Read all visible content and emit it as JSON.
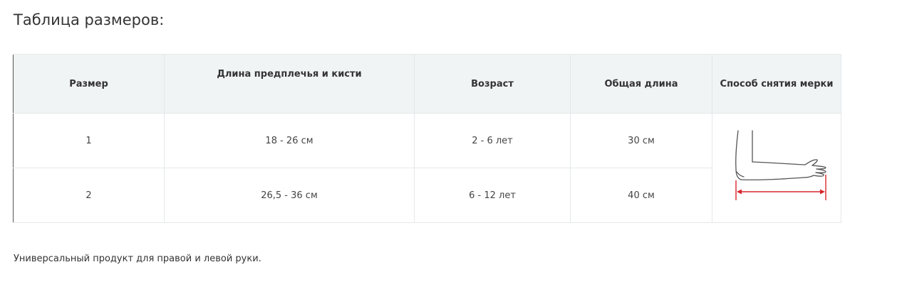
{
  "title": "Таблица размеров:",
  "table": {
    "headers": [
      "Размер",
      "Длина предплечья и кисти",
      "Возраст",
      "Общая длина",
      "Способ снятия мерки"
    ],
    "rows": [
      [
        "1",
        "18 - 26 см",
        "2 - 6 лет",
        "30 см"
      ],
      [
        "2",
        "26,5 - 36 см",
        "6 - 12 лет",
        "40 см"
      ]
    ]
  },
  "measure_image": {
    "icon": "arm-measurement-icon",
    "arrow_color": "#d9262c",
    "line_color": "#555555"
  },
  "note": "Универсальный продукт для правой и левой руки."
}
